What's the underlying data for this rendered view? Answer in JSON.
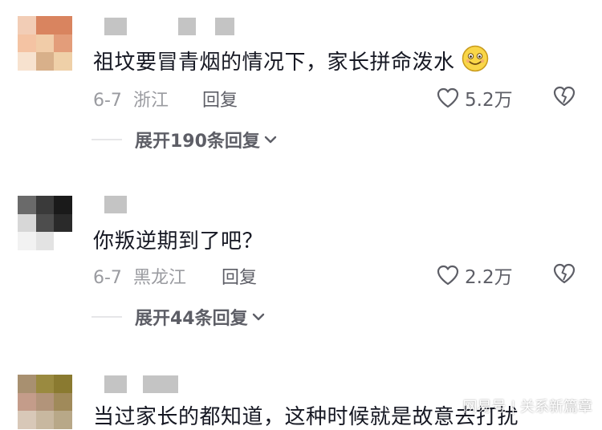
{
  "colors": {
    "text_primary": "#161823",
    "text_secondary": "#9a9ba0",
    "action_text": "#5d5e66",
    "divider": "#e6e6e8",
    "blur_gray": "#c4c4c4"
  },
  "comments": [
    {
      "text": "祖坟要冒青烟的情况下，家长拼命泼水",
      "emoji": "smiling-face-emoji",
      "date": "6-7",
      "region": "浙江",
      "reply_label": "回复",
      "likes": "5.2万",
      "expand_label": "展开190条回复"
    },
    {
      "text": "你叛逆期到了吧？",
      "date": "6-7",
      "region": "黑龙江",
      "reply_label": "回复",
      "likes": "2.2万",
      "expand_label": "展开44条回复"
    },
    {
      "text": "当过家长的都知道，这种时候就是故意去打扰"
    }
  ],
  "watermark": "网易号 | 关系新篇章",
  "icons": [
    "heart-outline-icon",
    "broken-heart-icon",
    "chevron-down-icon",
    "smiling-face-emoji"
  ]
}
